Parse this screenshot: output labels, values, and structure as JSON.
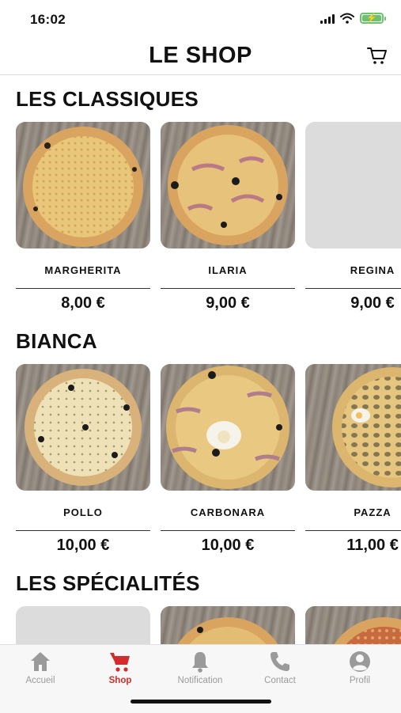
{
  "status_bar": {
    "time": "16:02"
  },
  "header": {
    "title": "LE SHOP"
  },
  "sections": [
    {
      "title": "LES CLASSIQUES",
      "items": [
        {
          "name": "MARGHERITA",
          "price": "8,00 €"
        },
        {
          "name": "ILARIA",
          "price": "9,00 €"
        },
        {
          "name": "REGINA",
          "price": "9,00 €"
        }
      ]
    },
    {
      "title": "BIANCA",
      "items": [
        {
          "name": "POLLO",
          "price": "10,00 €"
        },
        {
          "name": "CARBONARA",
          "price": "10,00 €"
        },
        {
          "name": "PAZZA",
          "price": "11,00 €"
        }
      ]
    },
    {
      "title": "LES SPÉCIALITÉS",
      "items": [
        {
          "name": "",
          "price": ""
        },
        {
          "name": "",
          "price": ""
        },
        {
          "name": "",
          "price": ""
        }
      ]
    }
  ],
  "tabbar": {
    "items": [
      {
        "label": "Accueil",
        "icon": "home-icon"
      },
      {
        "label": "Shop",
        "icon": "cart-icon",
        "active": true
      },
      {
        "label": "Notification",
        "icon": "bell-icon"
      },
      {
        "label": "Contact",
        "icon": "phone-icon"
      },
      {
        "label": "Profil",
        "icon": "profile-icon"
      }
    ]
  },
  "colors": {
    "accent": "#d42b2b",
    "inactive": "#9a9a9a",
    "battery": "#6bc46d"
  }
}
